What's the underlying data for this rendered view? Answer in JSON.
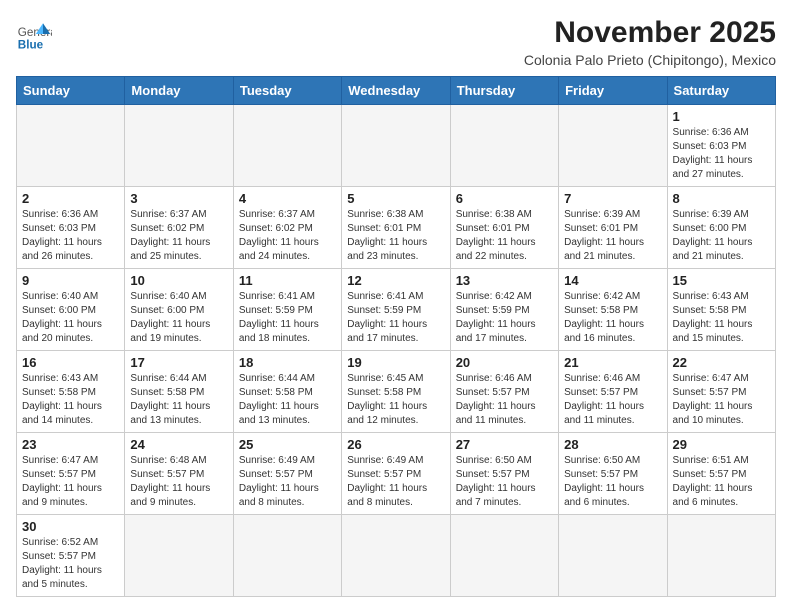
{
  "header": {
    "logo_general": "General",
    "logo_blue": "Blue",
    "month_year": "November 2025",
    "location": "Colonia Palo Prieto (Chipitongo), Mexico"
  },
  "days_of_week": [
    "Sunday",
    "Monday",
    "Tuesday",
    "Wednesday",
    "Thursday",
    "Friday",
    "Saturday"
  ],
  "weeks": [
    [
      {
        "day": "",
        "info": ""
      },
      {
        "day": "",
        "info": ""
      },
      {
        "day": "",
        "info": ""
      },
      {
        "day": "",
        "info": ""
      },
      {
        "day": "",
        "info": ""
      },
      {
        "day": "",
        "info": ""
      },
      {
        "day": "1",
        "info": "Sunrise: 6:36 AM\nSunset: 6:03 PM\nDaylight: 11 hours and 27 minutes."
      }
    ],
    [
      {
        "day": "2",
        "info": "Sunrise: 6:36 AM\nSunset: 6:03 PM\nDaylight: 11 hours and 26 minutes."
      },
      {
        "day": "3",
        "info": "Sunrise: 6:37 AM\nSunset: 6:02 PM\nDaylight: 11 hours and 25 minutes."
      },
      {
        "day": "4",
        "info": "Sunrise: 6:37 AM\nSunset: 6:02 PM\nDaylight: 11 hours and 24 minutes."
      },
      {
        "day": "5",
        "info": "Sunrise: 6:38 AM\nSunset: 6:01 PM\nDaylight: 11 hours and 23 minutes."
      },
      {
        "day": "6",
        "info": "Sunrise: 6:38 AM\nSunset: 6:01 PM\nDaylight: 11 hours and 22 minutes."
      },
      {
        "day": "7",
        "info": "Sunrise: 6:39 AM\nSunset: 6:01 PM\nDaylight: 11 hours and 21 minutes."
      },
      {
        "day": "8",
        "info": "Sunrise: 6:39 AM\nSunset: 6:00 PM\nDaylight: 11 hours and 21 minutes."
      }
    ],
    [
      {
        "day": "9",
        "info": "Sunrise: 6:40 AM\nSunset: 6:00 PM\nDaylight: 11 hours and 20 minutes."
      },
      {
        "day": "10",
        "info": "Sunrise: 6:40 AM\nSunset: 6:00 PM\nDaylight: 11 hours and 19 minutes."
      },
      {
        "day": "11",
        "info": "Sunrise: 6:41 AM\nSunset: 5:59 PM\nDaylight: 11 hours and 18 minutes."
      },
      {
        "day": "12",
        "info": "Sunrise: 6:41 AM\nSunset: 5:59 PM\nDaylight: 11 hours and 17 minutes."
      },
      {
        "day": "13",
        "info": "Sunrise: 6:42 AM\nSunset: 5:59 PM\nDaylight: 11 hours and 17 minutes."
      },
      {
        "day": "14",
        "info": "Sunrise: 6:42 AM\nSunset: 5:58 PM\nDaylight: 11 hours and 16 minutes."
      },
      {
        "day": "15",
        "info": "Sunrise: 6:43 AM\nSunset: 5:58 PM\nDaylight: 11 hours and 15 minutes."
      }
    ],
    [
      {
        "day": "16",
        "info": "Sunrise: 6:43 AM\nSunset: 5:58 PM\nDaylight: 11 hours and 14 minutes."
      },
      {
        "day": "17",
        "info": "Sunrise: 6:44 AM\nSunset: 5:58 PM\nDaylight: 11 hours and 13 minutes."
      },
      {
        "day": "18",
        "info": "Sunrise: 6:44 AM\nSunset: 5:58 PM\nDaylight: 11 hours and 13 minutes."
      },
      {
        "day": "19",
        "info": "Sunrise: 6:45 AM\nSunset: 5:58 PM\nDaylight: 11 hours and 12 minutes."
      },
      {
        "day": "20",
        "info": "Sunrise: 6:46 AM\nSunset: 5:57 PM\nDaylight: 11 hours and 11 minutes."
      },
      {
        "day": "21",
        "info": "Sunrise: 6:46 AM\nSunset: 5:57 PM\nDaylight: 11 hours and 11 minutes."
      },
      {
        "day": "22",
        "info": "Sunrise: 6:47 AM\nSunset: 5:57 PM\nDaylight: 11 hours and 10 minutes."
      }
    ],
    [
      {
        "day": "23",
        "info": "Sunrise: 6:47 AM\nSunset: 5:57 PM\nDaylight: 11 hours and 9 minutes."
      },
      {
        "day": "24",
        "info": "Sunrise: 6:48 AM\nSunset: 5:57 PM\nDaylight: 11 hours and 9 minutes."
      },
      {
        "day": "25",
        "info": "Sunrise: 6:49 AM\nSunset: 5:57 PM\nDaylight: 11 hours and 8 minutes."
      },
      {
        "day": "26",
        "info": "Sunrise: 6:49 AM\nSunset: 5:57 PM\nDaylight: 11 hours and 8 minutes."
      },
      {
        "day": "27",
        "info": "Sunrise: 6:50 AM\nSunset: 5:57 PM\nDaylight: 11 hours and 7 minutes."
      },
      {
        "day": "28",
        "info": "Sunrise: 6:50 AM\nSunset: 5:57 PM\nDaylight: 11 hours and 6 minutes."
      },
      {
        "day": "29",
        "info": "Sunrise: 6:51 AM\nSunset: 5:57 PM\nDaylight: 11 hours and 6 minutes."
      }
    ],
    [
      {
        "day": "30",
        "info": "Sunrise: 6:52 AM\nSunset: 5:57 PM\nDaylight: 11 hours and 5 minutes."
      },
      {
        "day": "",
        "info": ""
      },
      {
        "day": "",
        "info": ""
      },
      {
        "day": "",
        "info": ""
      },
      {
        "day": "",
        "info": ""
      },
      {
        "day": "",
        "info": ""
      },
      {
        "day": "",
        "info": ""
      }
    ]
  ]
}
